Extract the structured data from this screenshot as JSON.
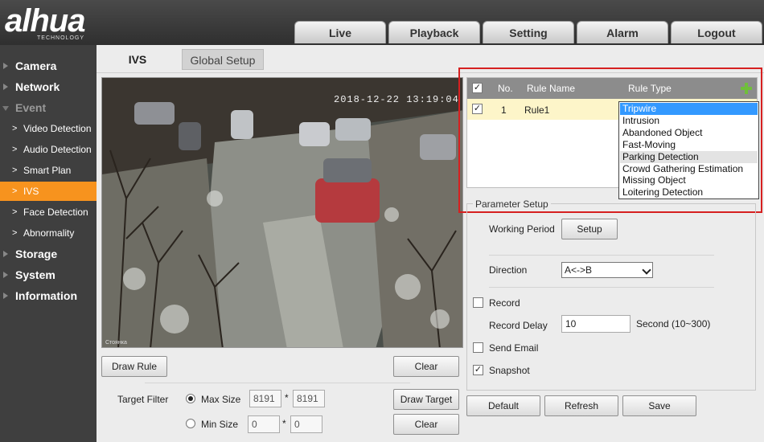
{
  "brand": {
    "logo": "alhua",
    "sub": "TECHNOLOGY"
  },
  "top_tabs": [
    "Live",
    "Playback",
    "Setting",
    "Alarm",
    "Logout"
  ],
  "sidebar": {
    "items": [
      "Camera",
      "Network",
      "Event",
      "Storage",
      "System",
      "Information"
    ],
    "event_subitems": [
      "Video Detection",
      "Audio Detection",
      "Smart Plan",
      "IVS",
      "Face Detection",
      "Abnormality"
    ],
    "active": "IVS"
  },
  "tabs": {
    "ivs": "IVS",
    "global": "Global Setup"
  },
  "video": {
    "timestamp": "2018-12-22 13:19:04",
    "watermark": "Cтоянка"
  },
  "left_controls": {
    "draw_rule": "Draw Rule",
    "clear": "Clear",
    "target_filter": "Target Filter",
    "max_size_label": "Max Size",
    "max_w": "8191",
    "max_h": "8191",
    "min_size_label": "Min Size",
    "min_w": "0",
    "min_h": "0",
    "times": "*",
    "draw_target": "Draw Target",
    "clear2": "Clear"
  },
  "rules_table": {
    "headers": {
      "no": "No.",
      "name": "Rule Name",
      "type": "Rule Type"
    },
    "rows": [
      {
        "no": "1",
        "name": "Rule1",
        "checked": true
      }
    ]
  },
  "rule_type_options": [
    "Tripwire",
    "Intrusion",
    "Abandoned Object",
    "Fast-Moving",
    "Parking Detection",
    "Crowd Gathering Estimation",
    "Missing Object",
    "Loitering Detection"
  ],
  "rule_type_selected": "Tripwire",
  "params": {
    "legend": "Parameter Setup",
    "working_period": "Working Period",
    "setup_btn": "Setup",
    "direction": "Direction",
    "direction_value": "A<->B",
    "record": "Record",
    "record_delay": "Record Delay",
    "record_delay_value": "10",
    "record_delay_unit": "Second (10~300)",
    "send_email": "Send Email",
    "snapshot": "Snapshot"
  },
  "footer_buttons": {
    "default": "Default",
    "refresh": "Refresh",
    "save": "Save"
  },
  "colors": {
    "accent": "#f7931e",
    "highlight_box": "#d62020",
    "selected_option": "#3399ff"
  }
}
